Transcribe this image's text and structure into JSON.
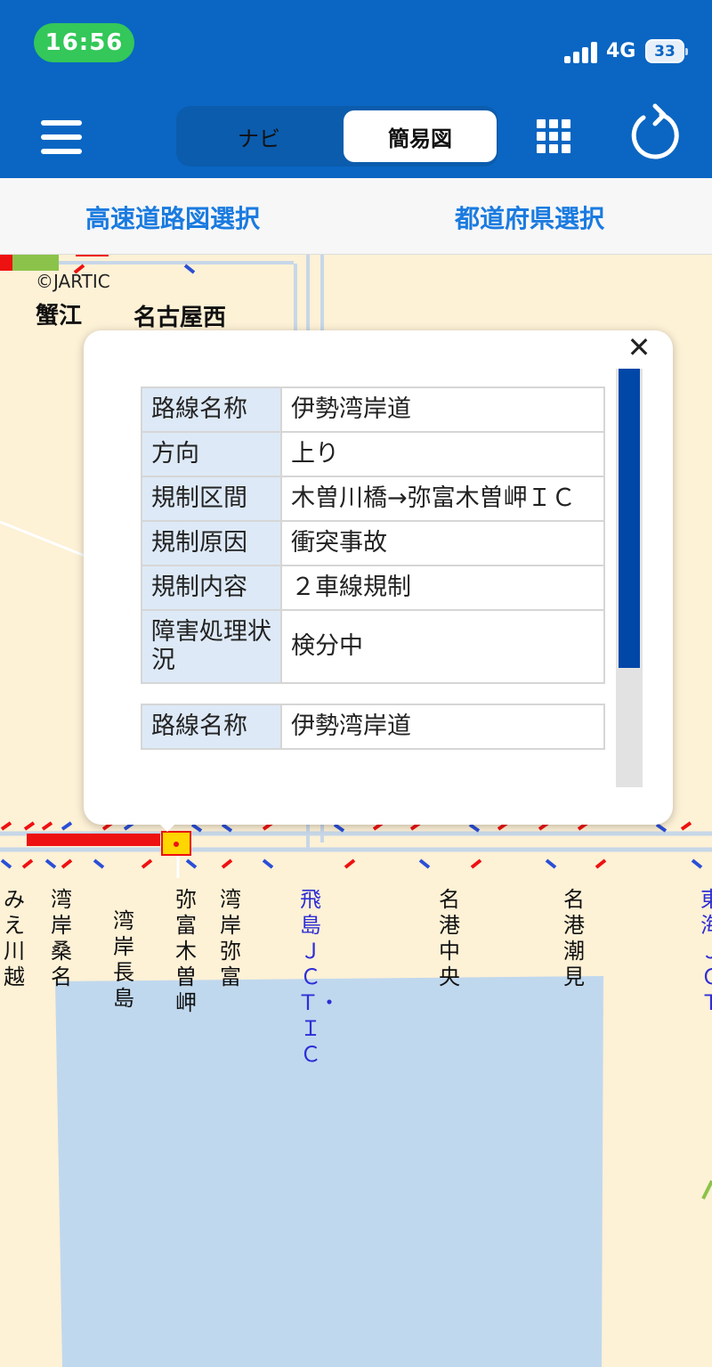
{
  "status_bar": {
    "time": "16:56",
    "network": "4G",
    "battery": "33"
  },
  "header": {
    "menu_icon": "hamburger-menu-icon",
    "tabs": [
      {
        "label": "ナビ",
        "selected": false
      },
      {
        "label": "簡易図",
        "selected": true
      }
    ],
    "grid_icon": "grid-icon",
    "refresh_icon": "refresh-icon",
    "background_color": "#0a66c2"
  },
  "subbar": {
    "highway_select": "高速道路図選択",
    "prefecture_select": "都道府県選択",
    "link_color": "#1a7be0"
  },
  "map": {
    "copyright": "©JARTIC",
    "top_labels": [
      "蟹江",
      "名古屋西"
    ],
    "interchanges": [
      {
        "label": "みえ川越",
        "type": "ic"
      },
      {
        "label": "湾岸桑名",
        "type": "ic"
      },
      {
        "label": "湾岸長島",
        "type": "ic"
      },
      {
        "label": "弥富木曽岬",
        "type": "ic"
      },
      {
        "label": "湾岸弥富",
        "type": "ic"
      },
      {
        "label": "飛島ＪＣＴ・ＩＣ",
        "type": "jct"
      },
      {
        "label": "名港中央",
        "type": "ic"
      },
      {
        "label": "名港潮見",
        "type": "ic"
      },
      {
        "label": "東海ＪＣＴ",
        "type": "jct"
      }
    ],
    "congestion_color": "#ee1111",
    "water_color": "#c0d8ee"
  },
  "popup": {
    "close_icon": "close-icon",
    "records": [
      {
        "rows": [
          {
            "key": "路線名称",
            "value": "伊勢湾岸道"
          },
          {
            "key": "方向",
            "value": "上り"
          },
          {
            "key": "規制区間",
            "value": "木曽川橋→弥富木曽岬ＩＣ"
          },
          {
            "key": "規制原因",
            "value": "衝突事故"
          },
          {
            "key": "規制内容",
            "value": "２車線規制"
          },
          {
            "key": "障害処理状況",
            "value": "検分中"
          }
        ]
      },
      {
        "rows": [
          {
            "key": "路線名称",
            "value": "伊勢湾岸道"
          }
        ]
      }
    ],
    "scroll_position": 0,
    "scroll_thumb_fraction": 0.71
  }
}
